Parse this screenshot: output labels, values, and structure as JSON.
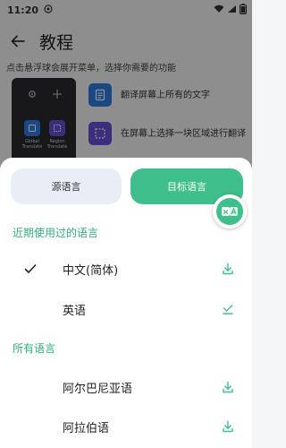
{
  "status_bar": {
    "time": "11:20"
  },
  "header": {
    "title": "教程"
  },
  "tutorial": {
    "instruction": "点击悬浮球会展开菜单，选择你需要的功能",
    "demo_labels": [
      "Global Translate",
      "Region Translate"
    ],
    "features": [
      {
        "text": "翻译屏幕上所有的文字"
      },
      {
        "text": "在屏幕上选择一块区域进行翻译"
      }
    ]
  },
  "sheet": {
    "source_tab": "源语言",
    "target_tab": "目标语言",
    "recent_header": "近期使用过的语言",
    "recent": [
      {
        "name": "中文(简体)",
        "selected": true,
        "action": "download-icon"
      },
      {
        "name": "英语",
        "selected": false,
        "action": "downloaded-icon"
      }
    ],
    "all_header": "所有语言",
    "all": [
      {
        "name": "阿尔巴尼亚语",
        "action": "download-icon"
      },
      {
        "name": "阿拉伯语",
        "action": "download-icon"
      }
    ]
  },
  "colors": {
    "accent": "#3fbf8b",
    "accent_text": "#2fae7c",
    "source_tab_bg": "#e8edf6",
    "demo_panel_bg": "#2a2a30"
  }
}
